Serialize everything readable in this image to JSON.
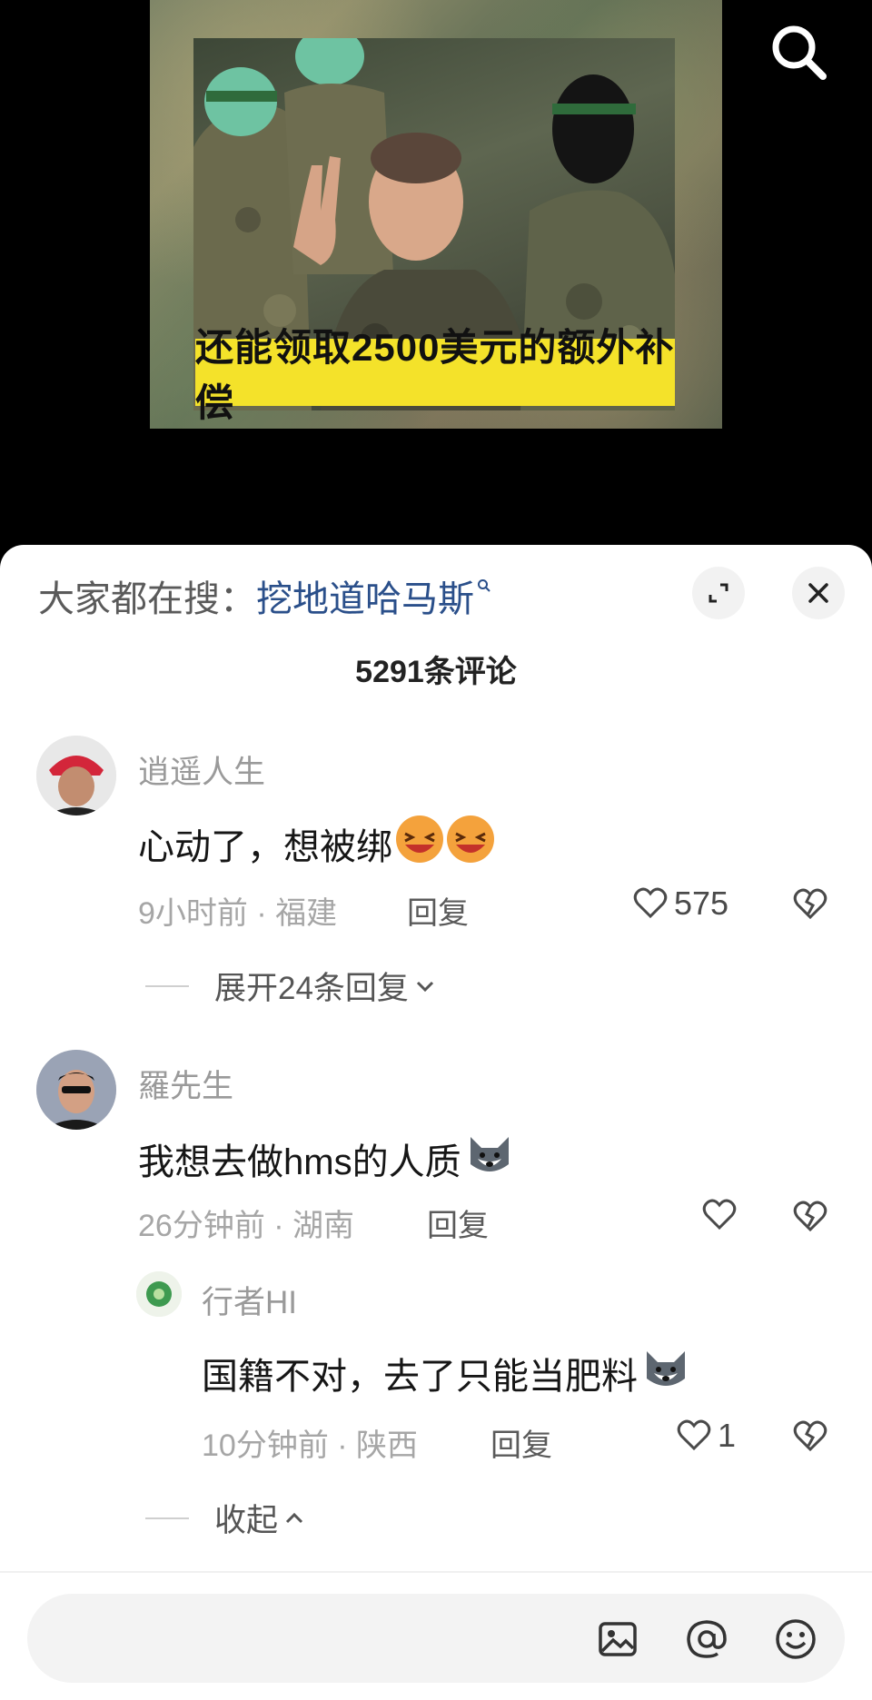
{
  "video": {
    "caption": "还能领取2500美元的额外补偿"
  },
  "sheet": {
    "trending_label": "大家都在搜：",
    "trending_term": "挖地道哈马斯",
    "trending_icon": "search-small-icon",
    "comment_count": "5291条评论"
  },
  "comments": [
    {
      "username": "逍遥人生",
      "text": "心动了，想被绑",
      "emoji": "laughing-emoji-icon",
      "meta": "9小时前 · 福建",
      "reply_label": "回复",
      "likes": "575",
      "expand_label": "展开24条回复"
    },
    {
      "username": "羅先生",
      "text": "我想去做hms的人质",
      "emoji": "wolf-emoji-icon",
      "meta": "26分钟前 · 湖南",
      "reply_label": "回复",
      "likes": ""
    }
  ],
  "replies": [
    {
      "username": "行者HI",
      "text": "国籍不对，去了只能当肥料",
      "emoji": "wolf-emoji-icon",
      "meta": "10分钟前 · 陕西",
      "reply_label": "回复",
      "likes": "1"
    }
  ],
  "collapse_label": "收起",
  "input": {
    "placeholder": "",
    "icons": [
      "image-icon",
      "at-icon",
      "emoji-icon"
    ]
  },
  "colors": {
    "caption_bg": "#f4e22a",
    "trending_term": "#2a4f8a",
    "sheet_bg": "#ffffff",
    "video_bg": "#000000"
  }
}
